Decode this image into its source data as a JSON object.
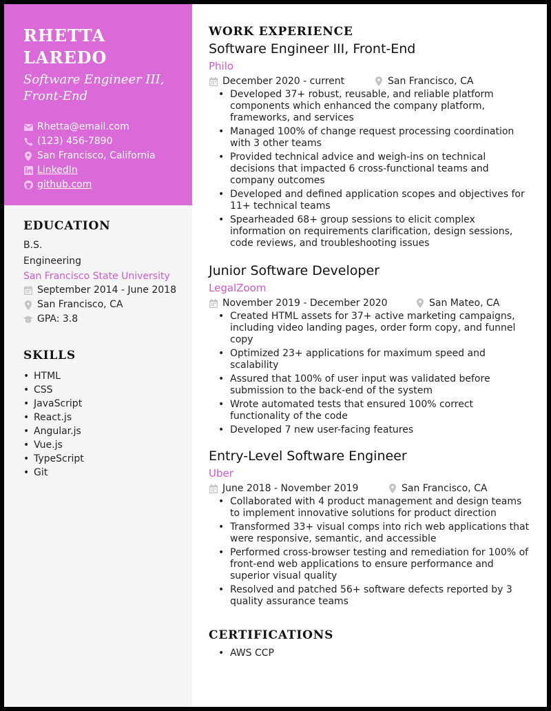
{
  "header": {
    "name": "RHETTA LAREDO",
    "title": "Software Engineer III, Front-End",
    "contacts": [
      {
        "icon": "envelope-icon",
        "text": "Rhetta@email.com",
        "link": false
      },
      {
        "icon": "phone-icon",
        "text": "(123) 456-7890",
        "link": false
      },
      {
        "icon": "location-pin-icon",
        "text": "San Francisco, California",
        "link": false
      },
      {
        "icon": "linkedin-icon",
        "text": "LinkedIn",
        "link": true
      },
      {
        "icon": "github-icon",
        "text": "github.com",
        "link": true
      }
    ]
  },
  "education": {
    "heading": "EDUCATION",
    "degree": "B.S.",
    "field": "Engineering",
    "school": "San Francisco State University",
    "dates": "September 2014 - June 2018",
    "location": "San Francisco, CA",
    "gpa": "GPA: 3.8"
  },
  "skills": {
    "heading": "SKILLS",
    "items": [
      "HTML",
      "CSS",
      "JavaScript",
      "React.js",
      "Angular.js",
      "Vue.js",
      "TypeScript",
      "Git"
    ]
  },
  "experience": {
    "heading": "WORK EXPERIENCE",
    "jobs": [
      {
        "title": "Software Engineer III, Front-End",
        "company": "Philo",
        "dates": "December 2020 - current",
        "location": "San Francisco, CA",
        "bullets": [
          "Developed 37+ robust, reusable, and reliable platform components which enhanced the company platform, frameworks, and services",
          "Managed 100% of change request processing coordination with 3 other teams",
          "Provided technical advice and weigh-ins on technical decisions that impacted 6 cross-functional teams and company outcomes",
          "Developed and defined application scopes and objectives for 11+ technical teams",
          "Spearheaded 68+ group sessions to elicit complex information on requirements clarification, design sessions, code reviews, and troubleshooting issues"
        ]
      },
      {
        "title": "Junior Software Developer",
        "company": "LegalZoom",
        "dates": "November 2019 - December 2020",
        "location": "San Mateo, CA",
        "bullets": [
          "Created HTML assets for 37+ active marketing campaigns, including video landing pages, order form copy, and funnel copy",
          "Optimized 23+ applications for maximum speed and scalability",
          "Assured that 100% of user input was validated before submission to the back-end of the system",
          "Wrote automated tests that ensured 100% correct functionality of the code",
          "Developed 7 new user-facing features"
        ]
      },
      {
        "title": "Entry-Level Software Engineer",
        "company": "Uber",
        "dates": "June 2018 - November 2019",
        "location": "San Francisco, CA",
        "bullets": [
          "Collaborated with 4 product management and design teams to implement innovative solutions for product direction",
          "Transformed 33+ visual comps into rich web applications that were responsive, semantic, and accessible",
          "Performed cross-browser testing and remediation for 100% of front-end web applications to ensure performance and superior visual quality",
          "Resolved and patched 56+ software defects reported by 3 quality assurance teams"
        ]
      }
    ]
  },
  "certifications": {
    "heading": "CERTIFICATIONS",
    "items": [
      "AWS CCP"
    ]
  },
  "colors": {
    "accent": "#da6ad8",
    "accent_text": "#cf59cd",
    "sidebar_bg": "#f5f5f5",
    "icon_gray": "#bdbdbd"
  }
}
